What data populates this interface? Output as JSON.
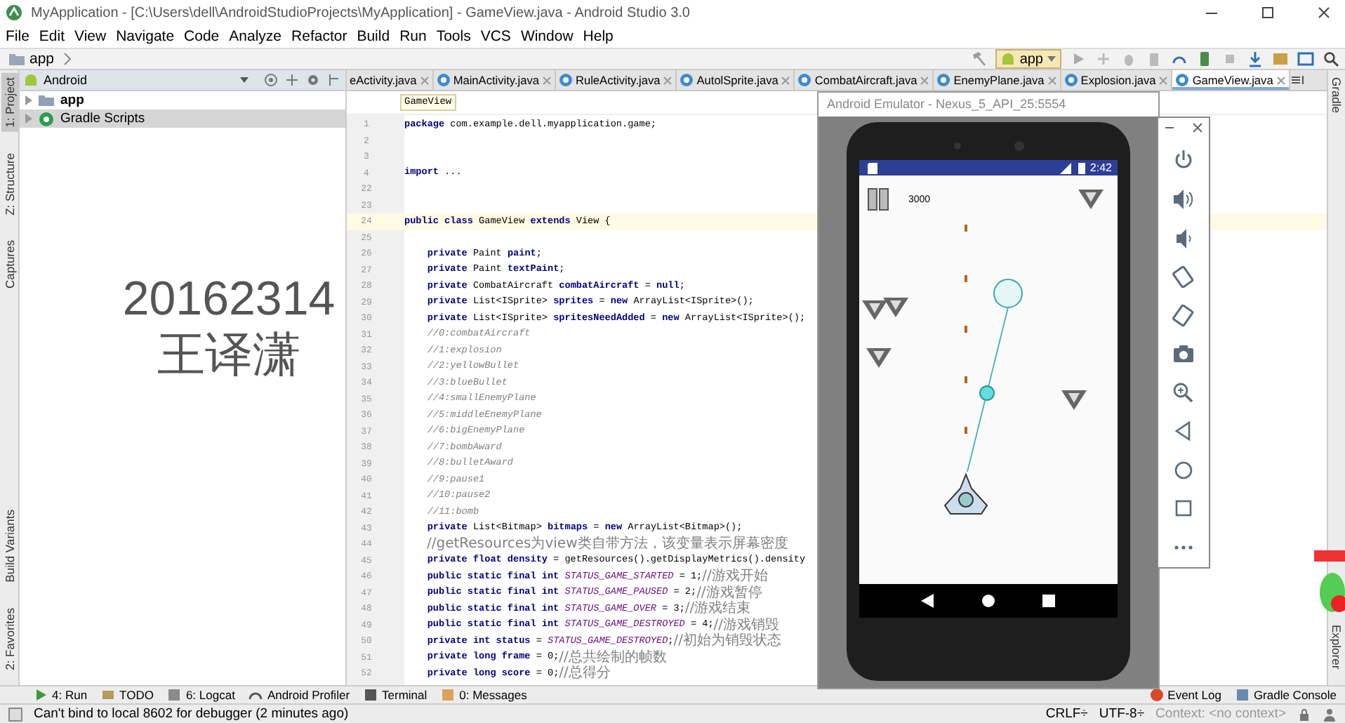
{
  "window": {
    "title": "MyApplication - [C:\\Users\\dell\\AndroidStudioProjects\\MyApplication] - GameView.java - Android Studio 3.0"
  },
  "menu": [
    "File",
    "Edit",
    "View",
    "Navigate",
    "Code",
    "Analyze",
    "Refactor",
    "Build",
    "Run",
    "Tools",
    "VCS",
    "Window",
    "Help"
  ],
  "navbar": {
    "breadcrumb": "app",
    "run_config": "app"
  },
  "left_tool_tabs": {
    "top": [
      {
        "label": "1: Project",
        "selected": true
      },
      {
        "label": "Z: Structure",
        "selected": false
      },
      {
        "label": "Captures",
        "selected": false
      }
    ],
    "bottom": [
      {
        "label": "Build Variants",
        "selected": false
      },
      {
        "label": "2: Favorites",
        "selected": false
      }
    ]
  },
  "project_panel": {
    "view_mode": "Android",
    "tree": [
      {
        "label": "app",
        "kind": "module",
        "selected": false
      },
      {
        "label": "Gradle Scripts",
        "kind": "gradle",
        "selected": true
      }
    ],
    "overlay_text": [
      "20162314",
      "王译潇"
    ]
  },
  "editor": {
    "tabs": [
      {
        "label": "eActivity.java",
        "selected": false,
        "clipped": true
      },
      {
        "label": "MainActivity.java",
        "selected": false,
        "clipped": false
      },
      {
        "label": "RuleActivity.java",
        "selected": false,
        "clipped": false
      },
      {
        "label": "AutolSprite.java",
        "selected": false,
        "clipped": false
      },
      {
        "label": "CombatAircraft.java",
        "selected": false,
        "clipped": false
      },
      {
        "label": "EnemyPlane.java",
        "selected": false,
        "clipped": false
      },
      {
        "label": "Explosion.java",
        "selected": false,
        "clipped": false
      },
      {
        "label": "GameView.java",
        "selected": true,
        "clipped": false
      }
    ],
    "breadcrumb": "GameView",
    "lines": [
      {
        "number": "1",
        "kind": "code",
        "code": "**package** com.example.dell.myapplication.game;",
        "current": false
      },
      {
        "number": "2",
        "current": false
      },
      {
        "number": "3",
        "current": false
      },
      {
        "number": "4",
        "kind": "code",
        "code": "**import** ...",
        "current": false
      },
      {
        "number": "22",
        "current": false
      },
      {
        "number": "23",
        "current": false
      },
      {
        "number": "24",
        "kind": "code",
        "code": "**public class** GameView **extends** View {",
        "current": true
      },
      {
        "number": "25",
        "current": false
      },
      {
        "number": "26",
        "kind": "code",
        "code": "    **private** Paint **paint**;",
        "current": false
      },
      {
        "number": "27",
        "kind": "code",
        "code": "    **private** Paint **textPaint**;",
        "current": false
      },
      {
        "number": "28",
        "kind": "code",
        "code": "    **private** CombatAircraft **combatAircraft** = **null**;",
        "current": false
      },
      {
        "number": "29",
        "kind": "code",
        "code": "    **private** List<ISprite> **sprites** = **new** ArrayList<ISprite>();",
        "current": false
      },
      {
        "number": "30",
        "kind": "code",
        "code": "    **private** List<ISprite> **spritesNeedAdded** = **new** ArrayList<ISprite>();",
        "current": false
      },
      {
        "number": "31",
        "kind": "comment",
        "code": "    //0:combatAircraft",
        "current": false
      },
      {
        "number": "32",
        "kind": "comment",
        "code": "    //1:explosion",
        "current": false
      },
      {
        "number": "33",
        "kind": "comment",
        "code": "    //2:yellowBullet",
        "current": false
      },
      {
        "number": "34",
        "kind": "comment",
        "code": "    //3:blueBullet",
        "current": false
      },
      {
        "number": "35",
        "kind": "comment",
        "code": "    //4:smallEnemyPlane",
        "current": false
      },
      {
        "number": "36",
        "kind": "comment",
        "code": "    //5:middleEnemyPlane",
        "current": false
      },
      {
        "number": "37",
        "kind": "comment",
        "code": "    //6:bigEnemyPlane",
        "current": false
      },
      {
        "number": "38",
        "kind": "comment",
        "code": "    //7:bombAward",
        "current": false
      },
      {
        "number": "39",
        "kind": "comment",
        "code": "    //8:bulletAward",
        "current": false
      },
      {
        "number": "40",
        "kind": "comment",
        "code": "    //9:pause1",
        "current": false
      },
      {
        "number": "41",
        "kind": "comment",
        "code": "    //10:pause2",
        "current": false
      },
      {
        "number": "42",
        "kind": "comment",
        "code": "    //11:bomb",
        "current": false
      },
      {
        "number": "43",
        "kind": "code",
        "code": "    **private** List<Bitmap> **bitmaps** = **new** ArrayList<Bitmap>();",
        "current": false
      },
      {
        "number": "44",
        "comment": "//getResources为view类自带方法，该变量表示屏幕密度",
        "current": false
      },
      {
        "number": "45",
        "kind": "code",
        "code": "    **private float density** = getResources().getDisplayMetrics().density",
        "current": false
      },
      {
        "number": "46",
        "kind": "code",
        "code": "    **public static final int** *STATUS_GAME_STARTED* = 1;",
        "comment": "//游戏开始",
        "current": false
      },
      {
        "number": "47",
        "kind": "code",
        "code": "    **public static final int** *STATUS_GAME_PAUSED* = 2;",
        "comment": "//游戏暂停",
        "current": false
      },
      {
        "number": "48",
        "kind": "code",
        "code": "    **public static final int** *STATUS_GAME_OVER* = 3;",
        "comment": "//游戏结束",
        "current": false
      },
      {
        "number": "49",
        "kind": "code",
        "code": "    **public static final int** *STATUS_GAME_DESTROYED* = 4;",
        "comment": "//游戏销毁",
        "current": false
      },
      {
        "number": "50",
        "kind": "code",
        "code": "    **private int status** = *STATUS_GAME_DESTROYED*;",
        "comment": "//初始为销毁状态",
        "current": false
      },
      {
        "number": "51",
        "kind": "code",
        "code": "    **private long frame** = 0;",
        "comment": "//总共绘制的帧数",
        "current": false
      },
      {
        "number": "52",
        "kind": "code",
        "code": "    **private long score** = 0;",
        "comment": "//总得分",
        "current": false
      }
    ]
  },
  "right_tool_tabs": {
    "top": [
      "Gradle"
    ],
    "bottom": [
      "Explorer"
    ]
  },
  "emulator": {
    "title": "Android Emulator - Nexus_5_API_25:5554",
    "time": "2:42",
    "score": "3000"
  },
  "bottom_tool_tabs": {
    "left": [
      "4: Run",
      "TODO",
      "6: Logcat",
      "Android Profiler",
      "Terminal",
      "0: Messages"
    ],
    "right": [
      "Event Log",
      "Gradle Console"
    ]
  },
  "status_bar": {
    "message": "Can't bind to local 8602 for debugger (2 minutes ago)",
    "line_separator": "CRLF÷",
    "encoding": "UTF-8÷",
    "context": "Context: <no context>"
  }
}
